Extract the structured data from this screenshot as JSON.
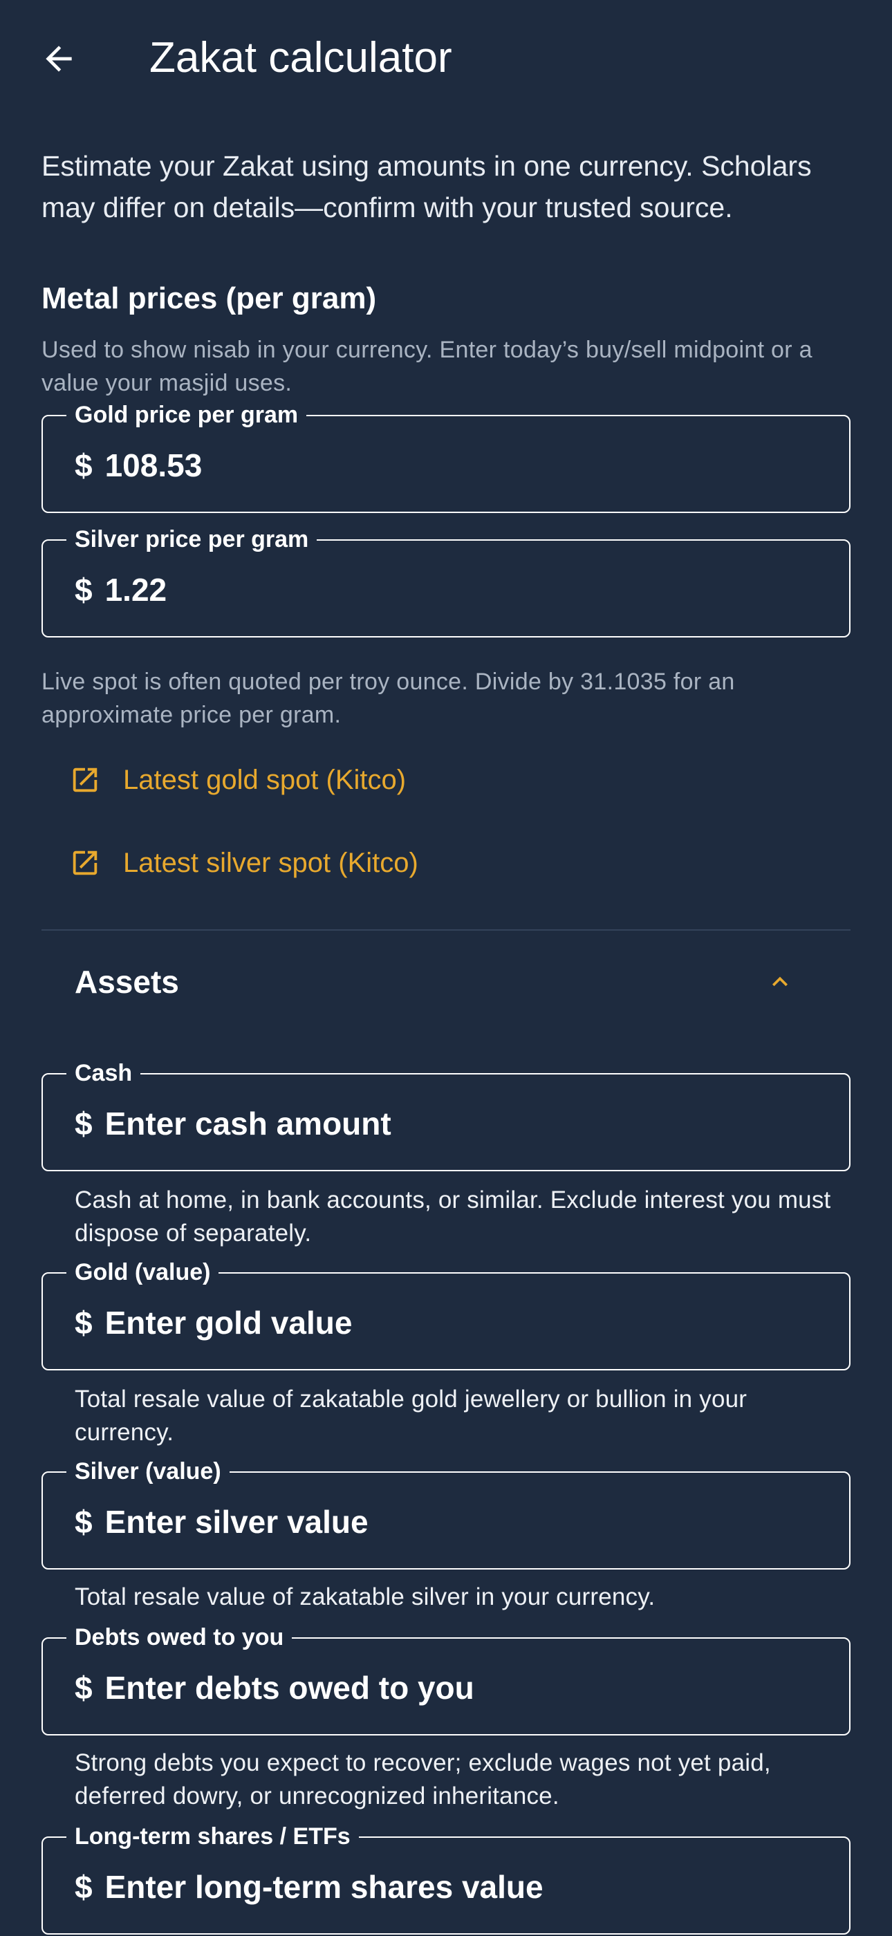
{
  "appbar": {
    "title": "Zakat calculator"
  },
  "intro": "Estimate your Zakat using amounts in one currency. Scholars may differ on details—confirm with your trusted source.",
  "metal_prices": {
    "title": "Metal prices (per gram)",
    "description": "Used to show nisab in your currency. Enter today’s buy/sell midpoint or a value your masjid uses.",
    "gold": {
      "label": "Gold price per gram",
      "prefix": "$",
      "value": "108.53"
    },
    "silver": {
      "label": "Silver price per gram",
      "prefix": "$",
      "value": "1.22"
    },
    "note": "Live spot is often quoted per troy ounce. Divide by 31.1035 for an approximate price per gram.",
    "links": [
      {
        "label": "Latest gold spot (Kitco)",
        "icon": "open-external-icon"
      },
      {
        "label": "Latest silver spot (Kitco)",
        "icon": "open-external-icon"
      }
    ]
  },
  "assets": {
    "title": "Assets",
    "expanded_icon": "chevron-up-icon",
    "fields": [
      {
        "label": "Cash",
        "prefix": "$",
        "placeholder": "Enter cash amount",
        "helper": "Cash at home, in bank accounts, or similar. Exclude interest you must dispose of separately."
      },
      {
        "label": "Gold (value)",
        "prefix": "$",
        "placeholder": "Enter gold value",
        "helper": "Total resale value of zakatable gold jewellery or bullion in your currency."
      },
      {
        "label": "Silver (value)",
        "prefix": "$",
        "placeholder": "Enter silver value",
        "helper": "Total resale value of zakatable silver in your currency."
      },
      {
        "label": "Debts owed to you",
        "prefix": "$",
        "placeholder": "Enter debts owed to you",
        "helper": "Strong debts you expect to recover; exclude wages not yet paid, deferred dowry, or unrecognized inheritance."
      },
      {
        "label": "Long-term shares / ETFs",
        "prefix": "$",
        "placeholder": "Enter long-term shares value"
      }
    ]
  },
  "colors": {
    "background": "#1e2b3f",
    "accent": "#e8a92e",
    "text": "#ffffff",
    "muted_text": "#aab4c2"
  }
}
